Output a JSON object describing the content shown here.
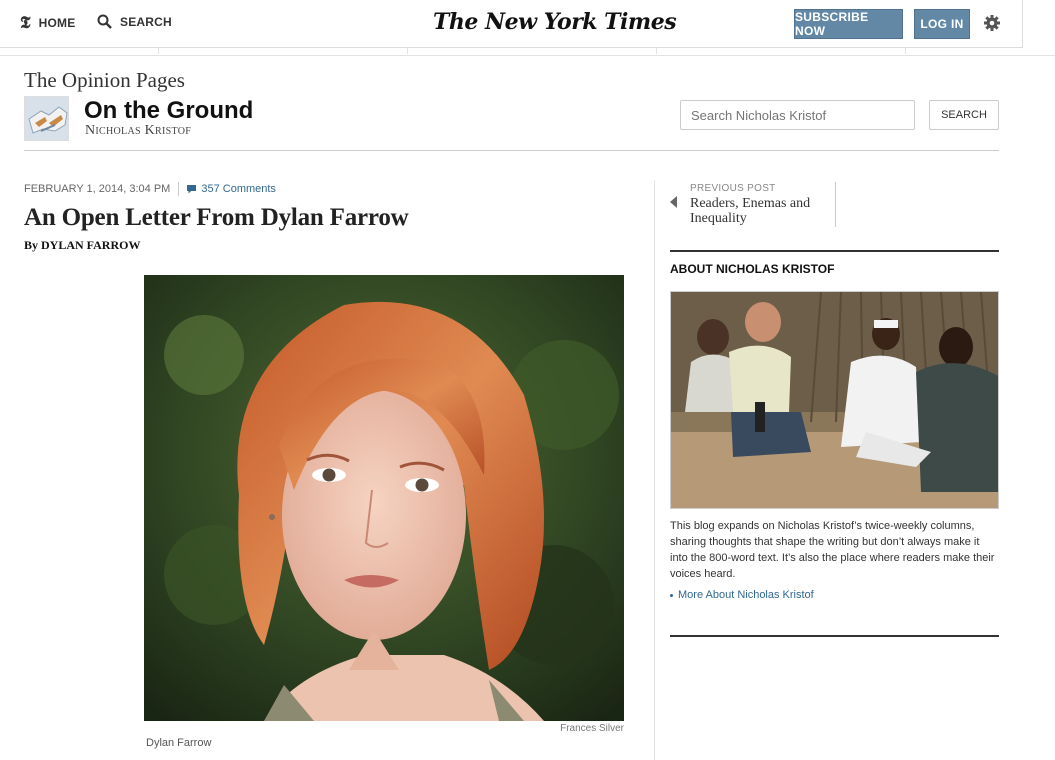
{
  "masthead": {
    "home_label": "HOME",
    "search_label": "SEARCH",
    "logo_text": "The New York Times",
    "subscribe_label": "SUBSCRIBE NOW",
    "login_label": "LOG IN",
    "settings_icon": "gear-icon"
  },
  "section": {
    "title": "The Opinion Pages",
    "blog_title": "On the Ground",
    "blog_author": "Nicholas Kristof",
    "search_placeholder": "Search Nicholas Kristof",
    "search_button": "SEARCH"
  },
  "article": {
    "date": "FEBRUARY 1, 2014, 3:04 PM",
    "comments": "357 Comments",
    "headline": "An Open Letter From Dylan Farrow",
    "byline": "By DYLAN FARROW",
    "photo_credit": "Frances Silver",
    "photo_caption": "Dylan Farrow"
  },
  "sidebar": {
    "previous_label": "PREVIOUS POST",
    "previous_title": "Readers, Enemas and Inequality",
    "about_heading": "ABOUT NICHOLAS KRISTOF",
    "about_text": "This blog expands on Nicholas Kristof’s twice-weekly columns, sharing thoughts that shape the writing but don’t always make it into the 800-word text. It’s also the place where readers make their voices heard.",
    "more_link": "More About Nicholas Kristof"
  },
  "colors": {
    "accent_blue": "#6288a5",
    "link_blue": "#326891"
  }
}
